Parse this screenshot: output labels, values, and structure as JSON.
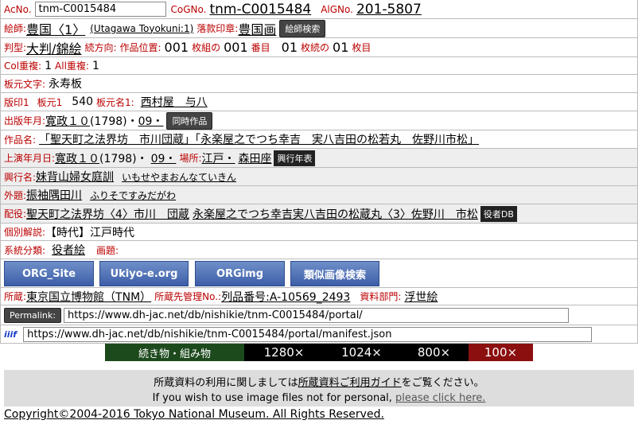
{
  "rows": {
    "acno_label": "AcNo.",
    "acno_value": "tnm-C0015484",
    "cogno_label": "CoGNo.",
    "cogno_value": "tnm-C0015484",
    "algno_label": "AlGNo.",
    "algno_value": "201-5807",
    "eshi_label": "絵師:",
    "eshi_value": "豊国〈1〉",
    "eshi_romaji": "(Utagawa Toyokuni:1)",
    "rakkan_label": "落款印章:",
    "rakkan_value": "豊国画",
    "eshi_search_btn": "絵師検索",
    "hankei_label": "判型:",
    "hankei_value": "大判/錦絵",
    "zoku_label": "続方向:",
    "ichi_label": "作品位置:",
    "ichi_value": "001",
    "maigumi_label": "枚組の",
    "maigumi_value": "001",
    "banme_label": "番目",
    "zoku_value": "01",
    "maizoku_label": "枚続の",
    "maizoku_value": "01",
    "maime_label": "枚目",
    "col_label": "Col重複:",
    "col_value": "1",
    "all_label": "All重複:",
    "all_value": "1",
    "hanmoto_label": "板元文字:",
    "hanmoto_value": "永寿板",
    "hanin_label": "版印1",
    "hanmoto1_label": "板元1",
    "hanmoto1_value": "540",
    "hanmotomei_label": "板元名1:",
    "hanmotomei_value": "西村屋　与八",
    "shuppan_label": "出版年月:",
    "shuppan_era": "寛政１０",
    "shuppan_year": "(1798)・",
    "shuppan_month": "09・",
    "doji_btn": "同時作品",
    "sakuhin_label": "作品名:",
    "sakuhin_value": "「聖天町之法界坊　市川団蔵」「永楽屋之でつち幸吉　実八吉田の松若丸　佐野川市松」",
    "joen_label": "上演年月日:",
    "joen_era": "寛政１０",
    "joen_year": "(1798)・",
    "joen_month": "09・",
    "basho_label": "場所:",
    "basho_value": "江戸・",
    "basho_theater": "森田座",
    "kogyo_btn": "興行年表",
    "kogyomei_label": "興行名:",
    "kogyomei_value": "妹背山婦女庭訓",
    "kogyomei_kana": "いもせやまおんなていきん",
    "gedai_label": "外題:",
    "gedai_value": "振袖隅田川",
    "gedai_kana": "ふりそですみだがわ",
    "haiyaku_label": "配役:",
    "haiyaku_value1": "聖天町之法界坊〈4〉市川　団蔵",
    "haiyaku_value2": "永楽屋之でつち幸吉実八吉田の松蔵丸〈3〉佐野川　市松",
    "yakusha_btn": "役者DB",
    "kobetsu_label": "個別解説:",
    "kobetsu_value": "【時代】江戸時代",
    "keito_label": "系統分類:",
    "keito_value": "役者絵",
    "gadai_label": "画題:",
    "shozo_label": "所蔵:",
    "shozo_value": "東京国立博物館（TNM）",
    "kanri_label": "所蔵先管理No.:",
    "kanri_value": "列品番号:A-10569_2493",
    "bumon_label": "資料部門:",
    "bumon_value": "浮世絵",
    "permalink_label": "Permalink:",
    "permalink_value": "https://www.dh-jac.net/db/nishikie/tnm-C0015484/portal/",
    "iiif_label": "iiif",
    "manifest_value": "https://www.dh-jac.net/db/nishikie/tnm-C0015484/portal/manifest.json"
  },
  "buttons": {
    "org_site": "ORG_Site",
    "ukiyoe": "Ukiyo-e.org",
    "orgimg": "ORGimg",
    "ruiji": "類似画像検索"
  },
  "size_bar": {
    "tsuzuki": "続き物・組み物",
    "s1280": "1280×",
    "s1024": "1024×",
    "s800": "800×",
    "s100": "100×"
  },
  "footer": {
    "line1_pre": "所蔵資料の利用に関しましては",
    "line1_link": "所蔵資料ご利用ガイド",
    "line1_post": "をご覧ください。",
    "line2_pre": "If you wish to use image files not for personal, ",
    "line2_link": "please click here."
  },
  "copyright": "Copyright©2004-2016 Tokyo National Museum. All Rights Reserved.",
  "colors": {
    "green": "#1d4a1d",
    "black": "#000000",
    "red": "#8b0f0f",
    "accent_label": "#b00000"
  }
}
